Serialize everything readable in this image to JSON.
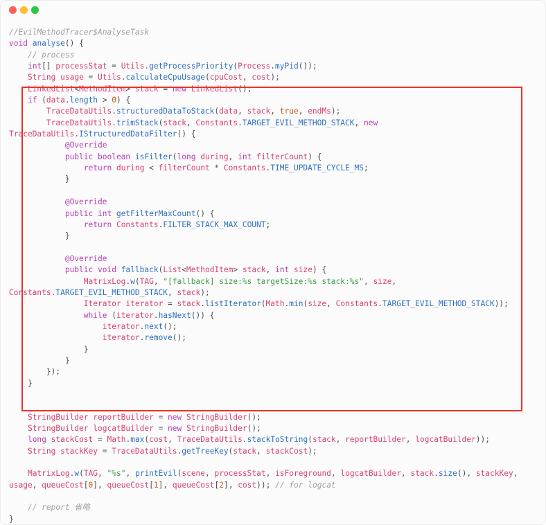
{
  "window": {
    "controls": [
      "close-icon",
      "minimize-icon",
      "maximize-icon"
    ],
    "colors": {
      "close": "#fe5f57",
      "minimize": "#febc2e",
      "maximize": "#28c840",
      "highlight": "#ee3026"
    }
  },
  "code_lines": [
    [
      {
        "text": "//EvilMethodTracer$AnalyseTask",
        "cls": "c"
      }
    ],
    [
      {
        "text": "void",
        "cls": "k"
      },
      {
        "text": " "
      },
      {
        "text": "analyse",
        "cls": "m"
      },
      {
        "text": "() {"
      }
    ],
    [
      {
        "text": "    "
      },
      {
        "text": "// process",
        "cls": "c"
      }
    ],
    [
      {
        "text": "    "
      },
      {
        "text": "int",
        "cls": "k"
      },
      {
        "text": "[] "
      },
      {
        "text": "processStat",
        "cls": "t"
      },
      {
        "text": " = "
      },
      {
        "text": "Utils",
        "cls": "t"
      },
      {
        "text": "."
      },
      {
        "text": "getProcessPriority",
        "cls": "m"
      },
      {
        "text": "("
      },
      {
        "text": "Process",
        "cls": "t"
      },
      {
        "text": "."
      },
      {
        "text": "myPid",
        "cls": "m"
      },
      {
        "text": "());"
      }
    ],
    [
      {
        "text": "    "
      },
      {
        "text": "String",
        "cls": "t"
      },
      {
        "text": " "
      },
      {
        "text": "usage",
        "cls": "t"
      },
      {
        "text": " = "
      },
      {
        "text": "Utils",
        "cls": "t"
      },
      {
        "text": "."
      },
      {
        "text": "calculateCpuUsage",
        "cls": "m"
      },
      {
        "text": "("
      },
      {
        "text": "cpuCost",
        "cls": "t"
      },
      {
        "text": ", "
      },
      {
        "text": "cost",
        "cls": "t"
      },
      {
        "text": ");"
      }
    ],
    [
      {
        "text": "    "
      },
      {
        "text": "LinkedList",
        "cls": "t"
      },
      {
        "text": "<"
      },
      {
        "text": "MethodItem",
        "cls": "t"
      },
      {
        "text": "> "
      },
      {
        "text": "stack",
        "cls": "t"
      },
      {
        "text": " = "
      },
      {
        "text": "new",
        "cls": "k"
      },
      {
        "text": " "
      },
      {
        "text": "LinkedList",
        "cls": "t"
      },
      {
        "text": "();"
      }
    ],
    [
      {
        "text": "    "
      },
      {
        "text": "if",
        "cls": "k"
      },
      {
        "text": " ("
      },
      {
        "text": "data",
        "cls": "t"
      },
      {
        "text": "."
      },
      {
        "text": "length",
        "cls": "m"
      },
      {
        "text": " > "
      },
      {
        "text": "0",
        "cls": "n"
      },
      {
        "text": ") {"
      }
    ],
    [
      {
        "text": "        "
      },
      {
        "text": "TraceDataUtils",
        "cls": "t"
      },
      {
        "text": "."
      },
      {
        "text": "structuredDataToStack",
        "cls": "m"
      },
      {
        "text": "("
      },
      {
        "text": "data",
        "cls": "t"
      },
      {
        "text": ", "
      },
      {
        "text": "stack",
        "cls": "t"
      },
      {
        "text": ", "
      },
      {
        "text": "true",
        "cls": "n"
      },
      {
        "text": ", "
      },
      {
        "text": "endMs",
        "cls": "t"
      },
      {
        "text": ");"
      }
    ],
    [
      {
        "text": "        "
      },
      {
        "text": "TraceDataUtils",
        "cls": "t"
      },
      {
        "text": "."
      },
      {
        "text": "trimStack",
        "cls": "m"
      },
      {
        "text": "("
      },
      {
        "text": "stack",
        "cls": "t"
      },
      {
        "text": ", "
      },
      {
        "text": "Constants",
        "cls": "t"
      },
      {
        "text": "."
      },
      {
        "text": "TARGET_EVIL_METHOD_STACK",
        "cls": "m"
      },
      {
        "text": ", "
      },
      {
        "text": "new",
        "cls": "k"
      }
    ],
    [
      {
        "text": "TraceDataUtils",
        "cls": "t"
      },
      {
        "text": "."
      },
      {
        "text": "IStructuredDataFilter",
        "cls": "m"
      },
      {
        "text": "() {"
      }
    ],
    [
      {
        "text": "            "
      },
      {
        "text": "@Override",
        "cls": "k"
      }
    ],
    [
      {
        "text": "            "
      },
      {
        "text": "public",
        "cls": "k"
      },
      {
        "text": " "
      },
      {
        "text": "boolean",
        "cls": "k"
      },
      {
        "text": " "
      },
      {
        "text": "isFilter",
        "cls": "m"
      },
      {
        "text": "("
      },
      {
        "text": "long",
        "cls": "k"
      },
      {
        "text": " "
      },
      {
        "text": "during",
        "cls": "t"
      },
      {
        "text": ", "
      },
      {
        "text": "int",
        "cls": "k"
      },
      {
        "text": " "
      },
      {
        "text": "filterCount",
        "cls": "t"
      },
      {
        "text": ") {"
      }
    ],
    [
      {
        "text": "                "
      },
      {
        "text": "return",
        "cls": "k"
      },
      {
        "text": " "
      },
      {
        "text": "during",
        "cls": "t"
      },
      {
        "text": " < "
      },
      {
        "text": "filterCount",
        "cls": "t"
      },
      {
        "text": " * "
      },
      {
        "text": "Constants",
        "cls": "t"
      },
      {
        "text": "."
      },
      {
        "text": "TIME_UPDATE_CYCLE_MS",
        "cls": "m"
      },
      {
        "text": ";"
      }
    ],
    [
      {
        "text": "            }"
      }
    ],
    [
      {
        "text": ""
      }
    ],
    [
      {
        "text": "            "
      },
      {
        "text": "@Override",
        "cls": "k"
      }
    ],
    [
      {
        "text": "            "
      },
      {
        "text": "public",
        "cls": "k"
      },
      {
        "text": " "
      },
      {
        "text": "int",
        "cls": "k"
      },
      {
        "text": " "
      },
      {
        "text": "getFilterMaxCount",
        "cls": "m"
      },
      {
        "text": "() {"
      }
    ],
    [
      {
        "text": "                "
      },
      {
        "text": "return",
        "cls": "k"
      },
      {
        "text": " "
      },
      {
        "text": "Constants",
        "cls": "t"
      },
      {
        "text": "."
      },
      {
        "text": "FILTER_STACK_MAX_COUNT",
        "cls": "m"
      },
      {
        "text": ";"
      }
    ],
    [
      {
        "text": "            }"
      }
    ],
    [
      {
        "text": ""
      }
    ],
    [
      {
        "text": "            "
      },
      {
        "text": "@Override",
        "cls": "k"
      }
    ],
    [
      {
        "text": "            "
      },
      {
        "text": "public",
        "cls": "k"
      },
      {
        "text": " "
      },
      {
        "text": "void",
        "cls": "k"
      },
      {
        "text": " "
      },
      {
        "text": "fallback",
        "cls": "m"
      },
      {
        "text": "("
      },
      {
        "text": "List",
        "cls": "t"
      },
      {
        "text": "<"
      },
      {
        "text": "MethodItem",
        "cls": "t"
      },
      {
        "text": "> "
      },
      {
        "text": "stack",
        "cls": "t"
      },
      {
        "text": ", "
      },
      {
        "text": "int",
        "cls": "k"
      },
      {
        "text": " "
      },
      {
        "text": "size",
        "cls": "t"
      },
      {
        "text": ") {"
      }
    ],
    [
      {
        "text": "                "
      },
      {
        "text": "MatrixLog",
        "cls": "t"
      },
      {
        "text": "."
      },
      {
        "text": "w",
        "cls": "m"
      },
      {
        "text": "("
      },
      {
        "text": "TAG",
        "cls": "t"
      },
      {
        "text": ", "
      },
      {
        "text": "\"[fallback] size:%s targetSize:%s stack:%s\"",
        "cls": "s"
      },
      {
        "text": ", "
      },
      {
        "text": "size",
        "cls": "t"
      },
      {
        "text": ","
      }
    ],
    [
      {
        "text": "Constants",
        "cls": "t"
      },
      {
        "text": "."
      },
      {
        "text": "TARGET_EVIL_METHOD_STACK",
        "cls": "m"
      },
      {
        "text": ", "
      },
      {
        "text": "stack",
        "cls": "t"
      },
      {
        "text": ");"
      }
    ],
    [
      {
        "text": "                "
      },
      {
        "text": "Iterator",
        "cls": "t"
      },
      {
        "text": " "
      },
      {
        "text": "iterator",
        "cls": "t"
      },
      {
        "text": " = "
      },
      {
        "text": "stack",
        "cls": "t"
      },
      {
        "text": "."
      },
      {
        "text": "listIterator",
        "cls": "m"
      },
      {
        "text": "("
      },
      {
        "text": "Math",
        "cls": "t"
      },
      {
        "text": "."
      },
      {
        "text": "min",
        "cls": "m"
      },
      {
        "text": "("
      },
      {
        "text": "size",
        "cls": "t"
      },
      {
        "text": ", "
      },
      {
        "text": "Constants",
        "cls": "t"
      },
      {
        "text": "."
      },
      {
        "text": "TARGET_EVIL_METHOD_STACK",
        "cls": "m"
      },
      {
        "text": "));"
      }
    ],
    [
      {
        "text": "                "
      },
      {
        "text": "while",
        "cls": "k"
      },
      {
        "text": " ("
      },
      {
        "text": "iterator",
        "cls": "t"
      },
      {
        "text": "."
      },
      {
        "text": "hasNext",
        "cls": "m"
      },
      {
        "text": "()) {"
      }
    ],
    [
      {
        "text": "                    "
      },
      {
        "text": "iterator",
        "cls": "t"
      },
      {
        "text": "."
      },
      {
        "text": "next",
        "cls": "m"
      },
      {
        "text": "();"
      }
    ],
    [
      {
        "text": "                    "
      },
      {
        "text": "iterator",
        "cls": "t"
      },
      {
        "text": "."
      },
      {
        "text": "remove",
        "cls": "m"
      },
      {
        "text": "();"
      }
    ],
    [
      {
        "text": "                }"
      }
    ],
    [
      {
        "text": "            }"
      }
    ],
    [
      {
        "text": "        });"
      }
    ],
    [
      {
        "text": "    }"
      }
    ],
    [
      {
        "text": ""
      }
    ],
    [
      {
        "text": ""
      }
    ],
    [
      {
        "text": "    "
      },
      {
        "text": "StringBuilder",
        "cls": "t"
      },
      {
        "text": " "
      },
      {
        "text": "reportBuilder",
        "cls": "t"
      },
      {
        "text": " = "
      },
      {
        "text": "new",
        "cls": "k"
      },
      {
        "text": " "
      },
      {
        "text": "StringBuilder",
        "cls": "t"
      },
      {
        "text": "();"
      }
    ],
    [
      {
        "text": "    "
      },
      {
        "text": "StringBuilder",
        "cls": "t"
      },
      {
        "text": " "
      },
      {
        "text": "logcatBuilder",
        "cls": "t"
      },
      {
        "text": " = "
      },
      {
        "text": "new",
        "cls": "k"
      },
      {
        "text": " "
      },
      {
        "text": "StringBuilder",
        "cls": "t"
      },
      {
        "text": "();"
      }
    ],
    [
      {
        "text": "    "
      },
      {
        "text": "long",
        "cls": "k"
      },
      {
        "text": " "
      },
      {
        "text": "stackCost",
        "cls": "t"
      },
      {
        "text": " = "
      },
      {
        "text": "Math",
        "cls": "t"
      },
      {
        "text": "."
      },
      {
        "text": "max",
        "cls": "m"
      },
      {
        "text": "("
      },
      {
        "text": "cost",
        "cls": "t"
      },
      {
        "text": ", "
      },
      {
        "text": "TraceDataUtils",
        "cls": "t"
      },
      {
        "text": "."
      },
      {
        "text": "stackToString",
        "cls": "m"
      },
      {
        "text": "("
      },
      {
        "text": "stack",
        "cls": "t"
      },
      {
        "text": ", "
      },
      {
        "text": "reportBuilder",
        "cls": "t"
      },
      {
        "text": ", "
      },
      {
        "text": "logcatBuilder",
        "cls": "t"
      },
      {
        "text": "));"
      }
    ],
    [
      {
        "text": "    "
      },
      {
        "text": "String",
        "cls": "t"
      },
      {
        "text": " "
      },
      {
        "text": "stackKey",
        "cls": "t"
      },
      {
        "text": " = "
      },
      {
        "text": "TraceDataUtils",
        "cls": "t"
      },
      {
        "text": "."
      },
      {
        "text": "getTreeKey",
        "cls": "m"
      },
      {
        "text": "("
      },
      {
        "text": "stack",
        "cls": "t"
      },
      {
        "text": ", "
      },
      {
        "text": "stackCost",
        "cls": "t"
      },
      {
        "text": ");"
      }
    ],
    [
      {
        "text": ""
      }
    ],
    [
      {
        "text": "    "
      },
      {
        "text": "MatrixLog",
        "cls": "t"
      },
      {
        "text": "."
      },
      {
        "text": "w",
        "cls": "m"
      },
      {
        "text": "("
      },
      {
        "text": "TAG",
        "cls": "t"
      },
      {
        "text": ", "
      },
      {
        "text": "\"%s\"",
        "cls": "s"
      },
      {
        "text": ", "
      },
      {
        "text": "printEvil",
        "cls": "m"
      },
      {
        "text": "("
      },
      {
        "text": "scene",
        "cls": "t"
      },
      {
        "text": ", "
      },
      {
        "text": "processStat",
        "cls": "t"
      },
      {
        "text": ", "
      },
      {
        "text": "isForeground",
        "cls": "t"
      },
      {
        "text": ", "
      },
      {
        "text": "logcatBuilder",
        "cls": "t"
      },
      {
        "text": ", "
      },
      {
        "text": "stack",
        "cls": "t"
      },
      {
        "text": "."
      },
      {
        "text": "size",
        "cls": "m"
      },
      {
        "text": "(), "
      },
      {
        "text": "stackKey",
        "cls": "t"
      },
      {
        "text": ","
      }
    ],
    [
      {
        "text": "usage",
        "cls": "t"
      },
      {
        "text": ", "
      },
      {
        "text": "queueCost",
        "cls": "t"
      },
      {
        "text": "["
      },
      {
        "text": "0",
        "cls": "n"
      },
      {
        "text": "], "
      },
      {
        "text": "queueCost",
        "cls": "t"
      },
      {
        "text": "["
      },
      {
        "text": "1",
        "cls": "n"
      },
      {
        "text": "], "
      },
      {
        "text": "queueCost",
        "cls": "t"
      },
      {
        "text": "["
      },
      {
        "text": "2",
        "cls": "n"
      },
      {
        "text": "], "
      },
      {
        "text": "cost",
        "cls": "t"
      },
      {
        "text": ")); "
      },
      {
        "text": "// for logcat",
        "cls": "c"
      }
    ],
    [
      {
        "text": ""
      }
    ],
    [
      {
        "text": "    "
      },
      {
        "text": "// report 省略",
        "cls": "c"
      }
    ],
    [
      {
        "text": "}"
      }
    ]
  ]
}
